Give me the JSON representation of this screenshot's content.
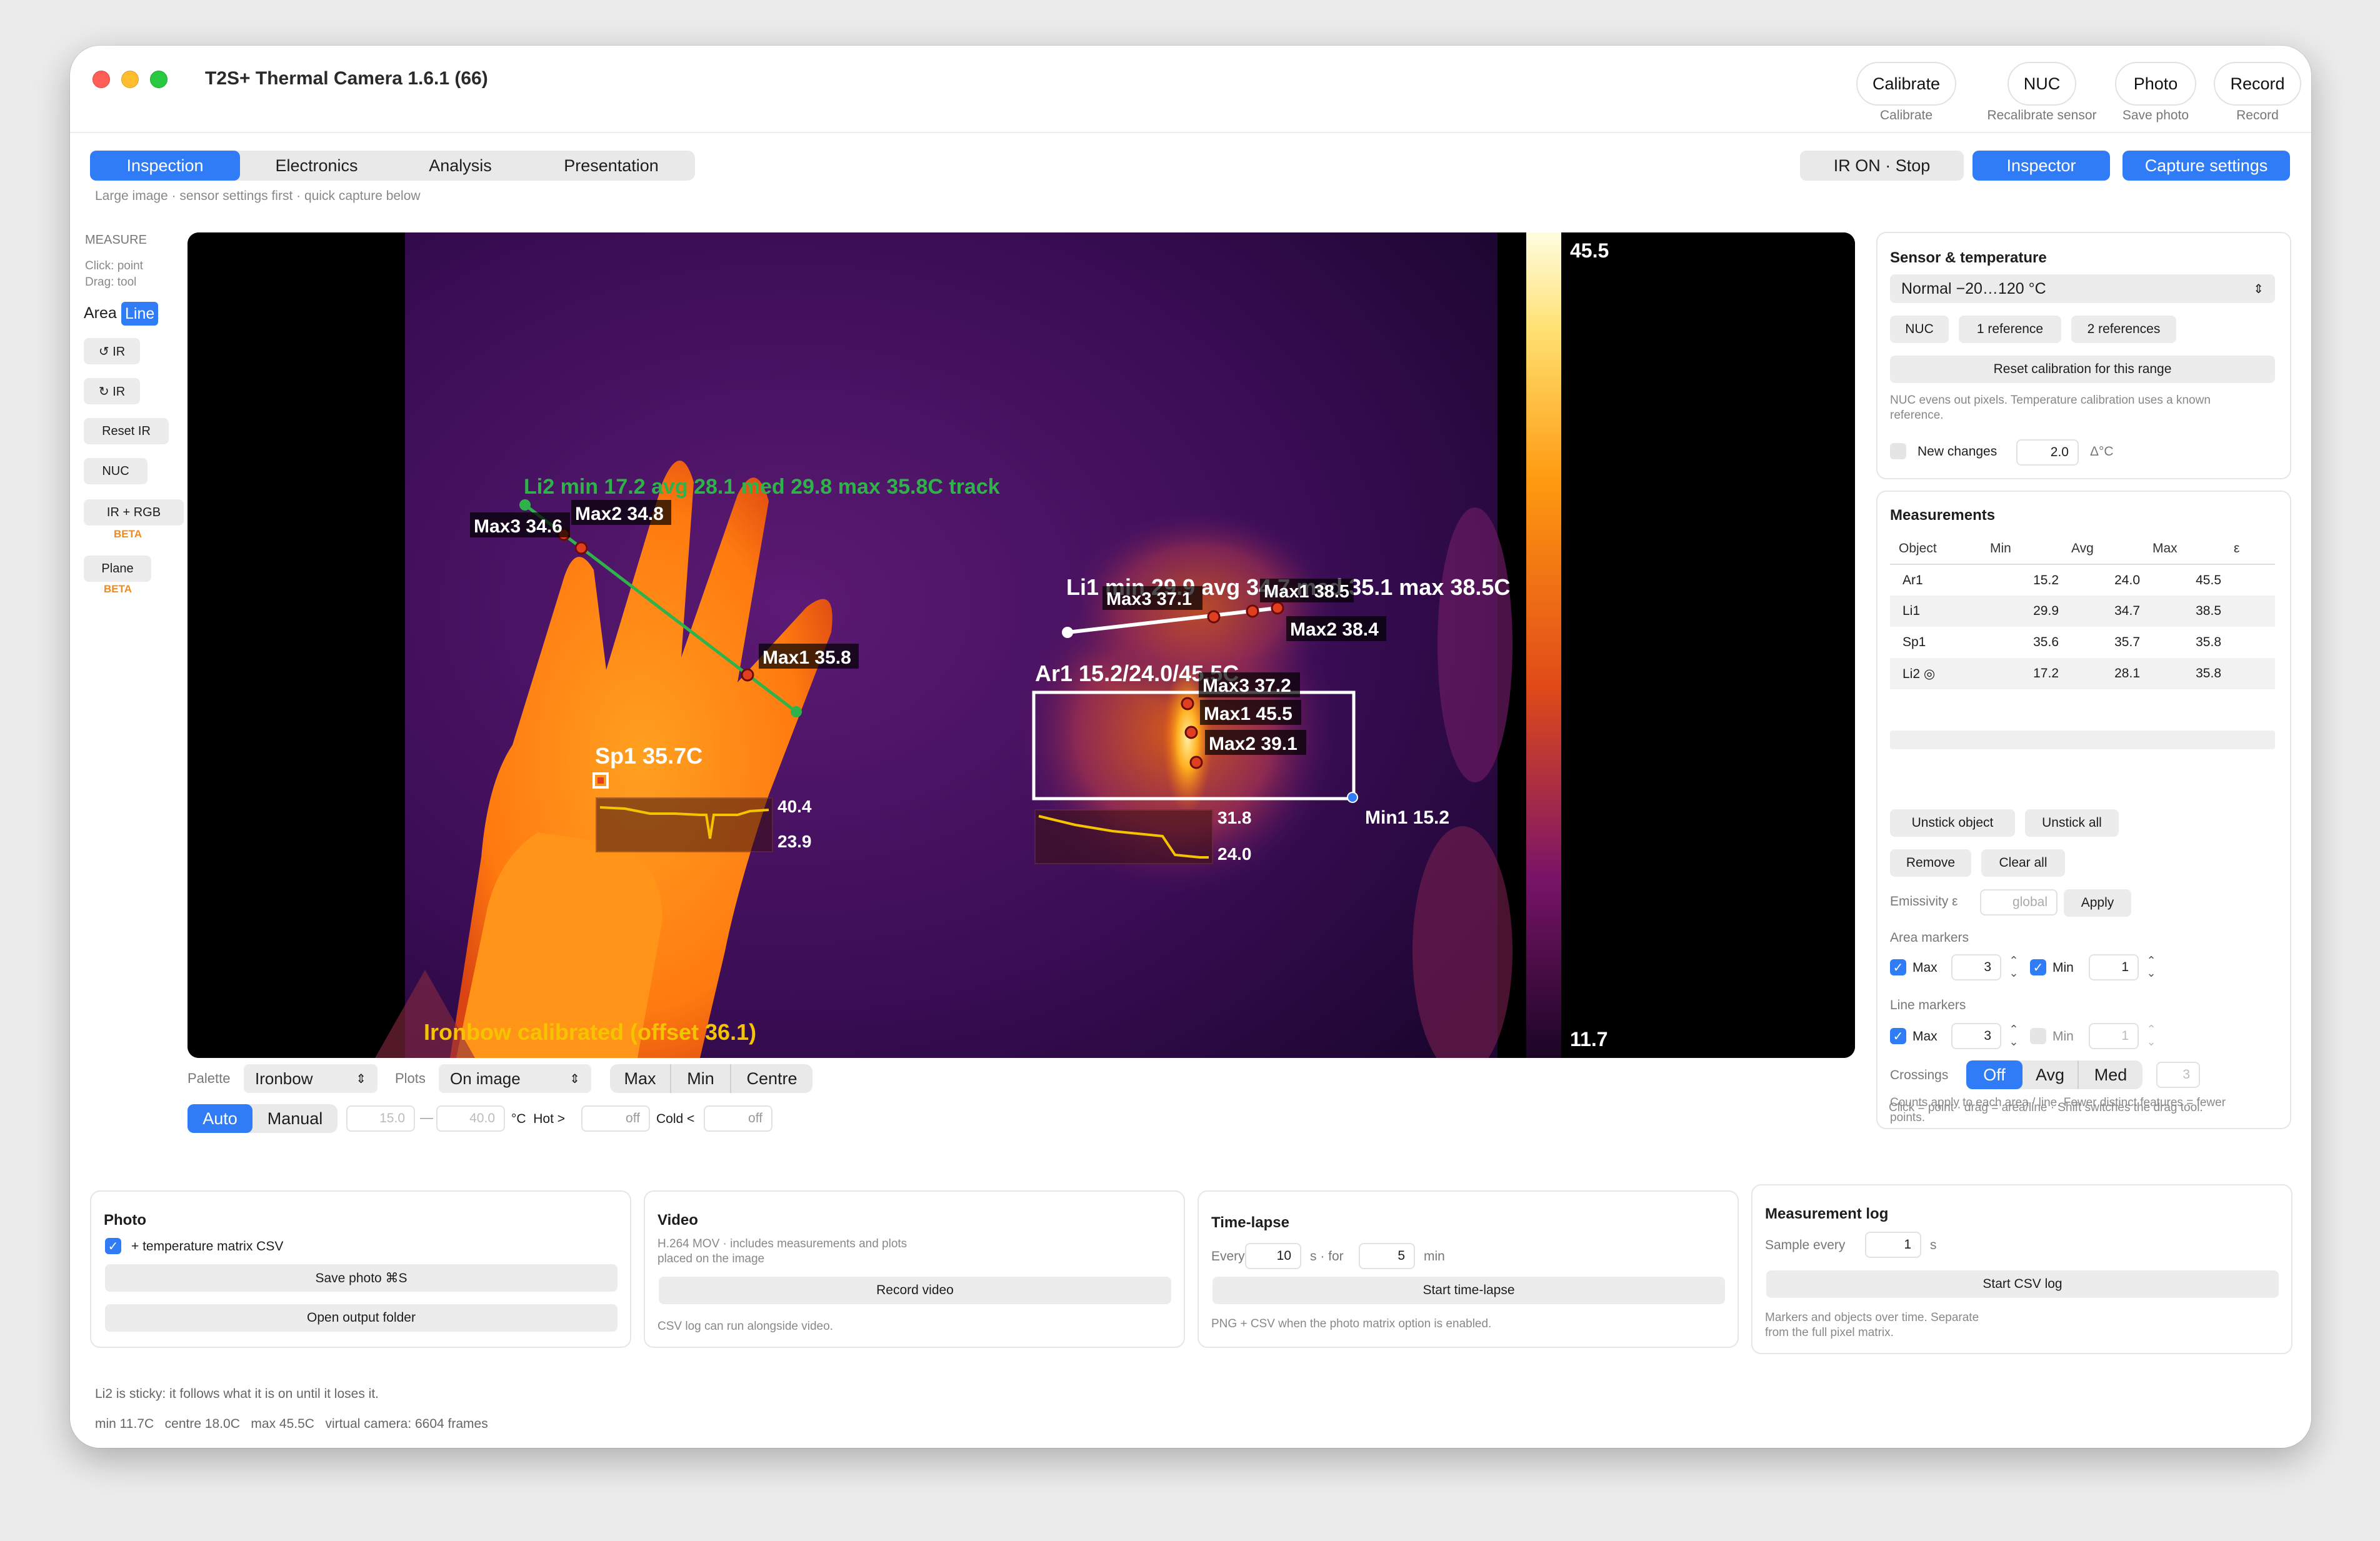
{
  "window": {
    "title": "T2S+ Thermal Camera 1.6.1 (66)"
  },
  "header_buttons": [
    {
      "label": "Calibrate",
      "sub": "Calibrate"
    },
    {
      "label": "NUC",
      "sub": "Recalibrate sensor"
    },
    {
      "label": "Photo",
      "sub": "Save photo"
    },
    {
      "label": "Record",
      "sub": "Record"
    }
  ],
  "tabs": [
    {
      "label": "Inspection",
      "active": true
    },
    {
      "label": "Electronics",
      "active": false
    },
    {
      "label": "Analysis",
      "active": false
    },
    {
      "label": "Presentation",
      "active": false
    }
  ],
  "subtitle": "Large image · sensor settings first · quick capture below",
  "top_right": {
    "ir_status": "IR ON · Stop",
    "inspector": "Inspector",
    "capture": "Capture settings"
  },
  "toolbar": {
    "heading": "MEASURE",
    "hint1": "Click: point",
    "hint2": "Drag: tool",
    "area": "Area",
    "line": "Line",
    "rot_ccw": "↺ IR",
    "rot_cw": "↻ IR",
    "reset": "Reset IR",
    "nuc": "NUC",
    "ir_rgb": "IR + RGB",
    "beta": "BETA",
    "plane": "Plane"
  },
  "camera": {
    "scale_max": "45.5",
    "scale_min": "11.7",
    "status": "Ironbow  calibrated (offset 36.1)",
    "li2_label": "Li2 min 17.2  avg 28.1  med 29.8  max 35.8C  track",
    "li1_label": "Li1 min 29.9  avg 34.7  med 35.1  max 38.5C",
    "ar1_label": "Ar1 15.2/24.0/45.5C",
    "sp1_label": "Sp1 35.7C",
    "markers": {
      "li2_max3": "Max3 34.6",
      "li2_max2": "Max2 34.8",
      "li2_max1": "Max1 35.8",
      "li1_max3": "Max3 37.1",
      "li1_max1": "Max1 38.5",
      "li1_max2": "Max2 38.4",
      "ar1_max3": "Max3 37.2",
      "ar1_max1": "Max1 45.5",
      "ar1_max2": "Max2 39.1",
      "ar1_min1": "Min1 15.2"
    },
    "sp1_plot": {
      "max": "40.4",
      "min": "23.9"
    },
    "ar1_plot": {
      "max": "31.8",
      "min": "24.0"
    }
  },
  "palette_bar": {
    "palette_label": "Palette",
    "palette_value": "Ironbow",
    "plots_label": "Plots",
    "plots_value": "On image",
    "modes": [
      "Max",
      "Min",
      "Centre"
    ],
    "auto": "Auto",
    "manual": "Manual",
    "range_low": "15.0",
    "dash": "—",
    "range_high": "40.0",
    "unit_hot": "°C  Hot >",
    "hot_value": "off",
    "cold_label": "Cold <",
    "cold_value": "off"
  },
  "sensor_panel": {
    "title": "Sensor & temperature",
    "range": "Normal  −20…120 °C",
    "nuc": "NUC",
    "ref1": "1 reference",
    "ref2": "2 references",
    "reset": "Reset calibration for this range",
    "note": "NUC evens out pixels. Temperature calibration uses a known reference.",
    "new_changes": "New changes",
    "threshold": "2.0",
    "delta_unit": "Δ°C"
  },
  "measurements": {
    "title": "Measurements",
    "columns": [
      "Object",
      "Min",
      "Avg",
      "Max",
      "ε"
    ],
    "rows": [
      {
        "object": "Ar1",
        "min": "15.2",
        "avg": "24.0",
        "max": "45.5",
        "eps": ""
      },
      {
        "object": "Li1",
        "min": "29.9",
        "avg": "34.7",
        "max": "38.5",
        "eps": ""
      },
      {
        "object": "Sp1",
        "min": "35.6",
        "avg": "35.7",
        "max": "35.8",
        "eps": ""
      },
      {
        "object": "Li2 ◎",
        "min": "17.2",
        "avg": "28.1",
        "max": "35.8",
        "eps": ""
      }
    ],
    "unstick": "Unstick object",
    "unstick_all": "Unstick all",
    "remove": "Remove",
    "clear_all": "Clear all",
    "emissivity_label": "Emissivity ε",
    "emissivity_placeholder": "global",
    "apply": "Apply",
    "area_markers": "Area markers",
    "line_markers": "Line markers",
    "max_label": "Max",
    "min_label": "Min",
    "area_max": "3",
    "area_min": "1",
    "line_max": "3",
    "line_min": "1",
    "crossings_label": "Crossings",
    "crossings": [
      "Off",
      "Avg",
      "Med"
    ],
    "crossings_value": "3",
    "note1": "Counts apply to each area / line. Fewer distinct features = fewer points.",
    "note2": "Click = point · drag = area/line · Shift switches the drag tool."
  },
  "photo": {
    "title": "Photo",
    "checkbox": "+ temperature matrix CSV",
    "save": "Save photo  ⌘S",
    "open": "Open output folder"
  },
  "video": {
    "title": "Video",
    "desc": "H.264 MOV · includes measurements and plots placed on the image",
    "record": "Record video",
    "note": "CSV log can run alongside video."
  },
  "timelapse": {
    "title": "Time-lapse",
    "every": "Every",
    "every_value": "10",
    "for_label": "s · for",
    "for_value": "5",
    "min_label": "min",
    "start": "Start time-lapse",
    "note": "PNG + CSV when the photo matrix option is enabled."
  },
  "log": {
    "title": "Measurement log",
    "sample": "Sample every",
    "sample_value": "1",
    "s": "s",
    "start": "Start CSV log",
    "note": "Markers and objects over time. Separate from the full pixel matrix."
  },
  "footer": {
    "sticky": "Li2 is sticky: it follows what it is on until it loses it.",
    "stats": "min 11.7C   centre 18.0C   max 45.5C   virtual camera: 6604 frames"
  },
  "colors": {
    "accent": "#2f7cf6",
    "beta": "#f28a1a",
    "li2": "#2fb24a",
    "status": "#f5c400"
  }
}
